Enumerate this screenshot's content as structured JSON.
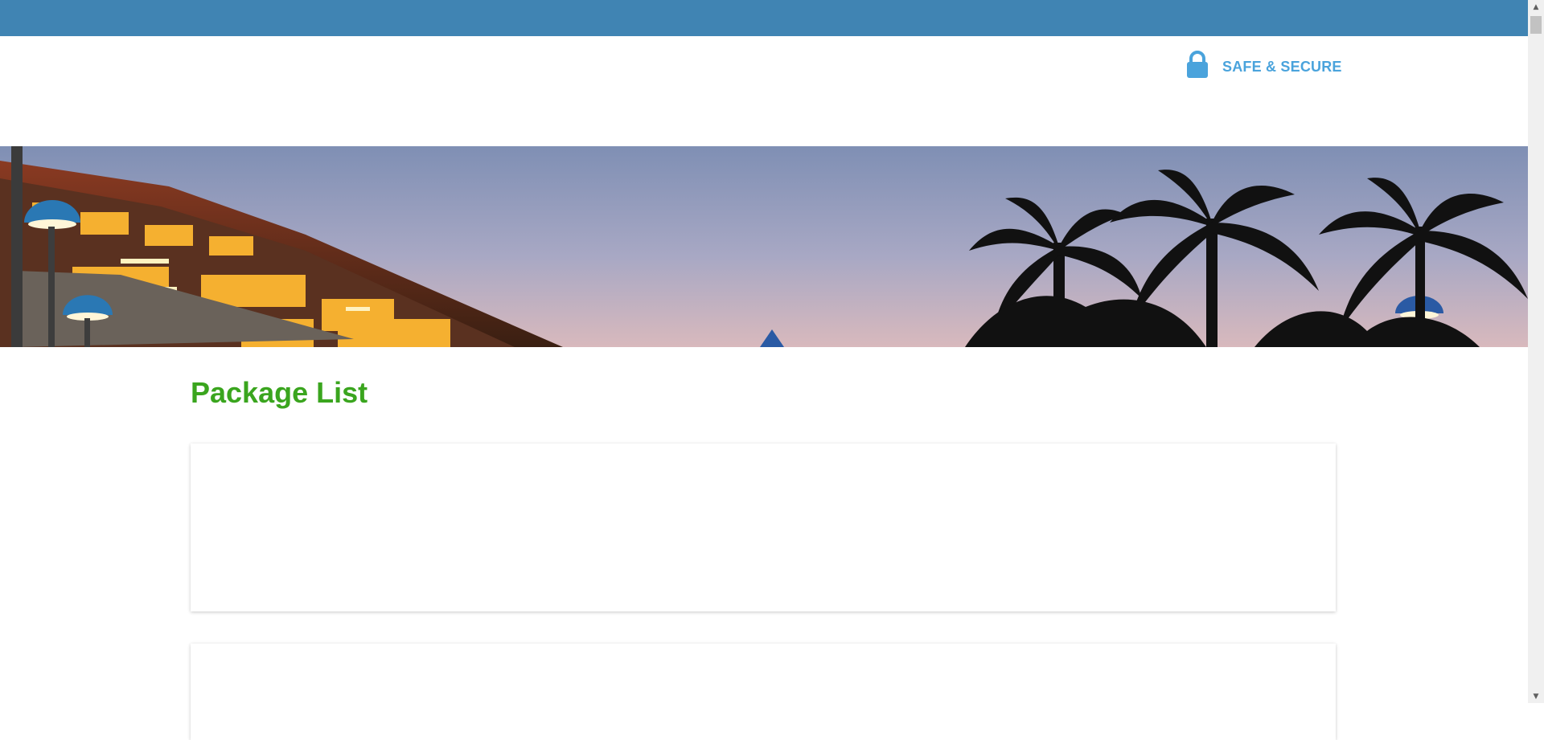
{
  "header": {
    "secure_label": "SAFE & SECURE",
    "secure_icon": "lock-icon"
  },
  "banner": {
    "alt": "Hotel terrace with palm trees at dusk"
  },
  "main": {
    "title": "Package List",
    "packages": [
      {
        "id": "package-1"
      },
      {
        "id": "package-2"
      }
    ]
  },
  "colors": {
    "topbar": "#4084b3",
    "accent_blue": "#4aa3dc",
    "title_green": "#3aa51e"
  }
}
